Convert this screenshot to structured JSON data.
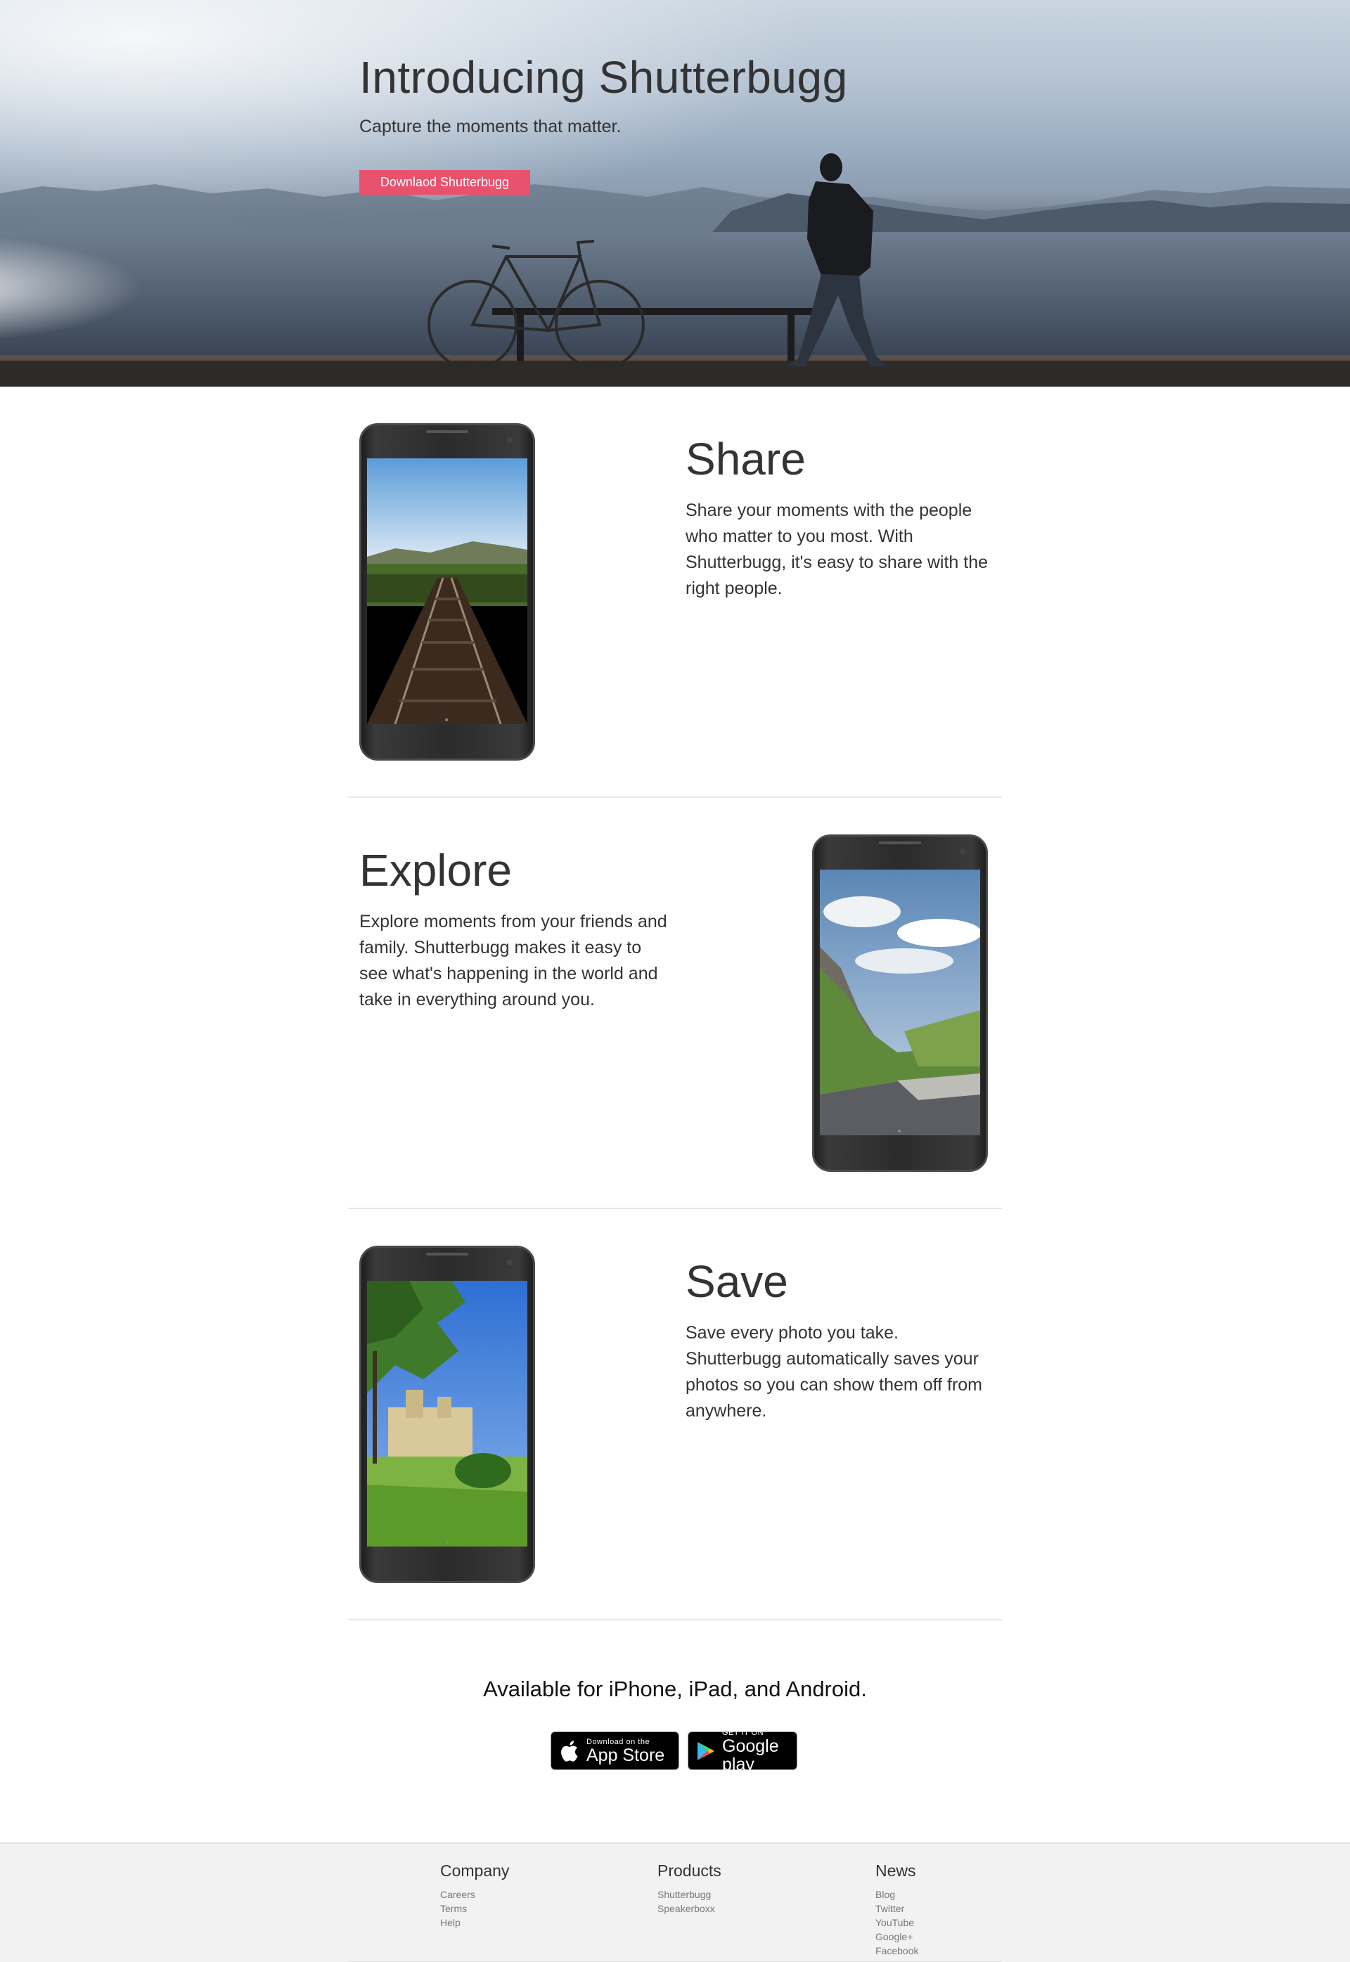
{
  "hero": {
    "title": "Introducing Shutterbugg",
    "subtitle": "Capture the moments that matter.",
    "button_label": "Downlaod Shutterbugg",
    "button_color": "#e8526d"
  },
  "features": [
    {
      "title": "Share",
      "text": "Share your moments with the people who matter to you most. With Shutterbugg, it's easy to share with the right people."
    },
    {
      "title": "Explore",
      "text": "Explore moments from your friends and family. Shutterbugg makes it easy to see what's happening in the world and take in everything around you."
    },
    {
      "title": "Save",
      "text": "Save every photo you take. Shutterbugg automatically saves your photos so you can show them off from anywhere."
    }
  ],
  "available": {
    "text": "Available for iPhone, iPad, and Android.",
    "app_store": {
      "small": "Download on the",
      "big": "App Store",
      "icon": "apple-icon"
    },
    "google_play": {
      "small": "GET IT ON",
      "big": "Google play",
      "icon": "google-play-icon"
    }
  },
  "footer": {
    "columns": [
      {
        "heading": "Company",
        "links": [
          "Careers",
          "Terms",
          "Help"
        ]
      },
      {
        "heading": "Products",
        "links": [
          "Shutterbugg",
          "Speakerboxx"
        ]
      },
      {
        "heading": "News",
        "links": [
          "Blog",
          "Twitter",
          "YouTube",
          "Google+",
          "Facebook"
        ]
      }
    ]
  }
}
